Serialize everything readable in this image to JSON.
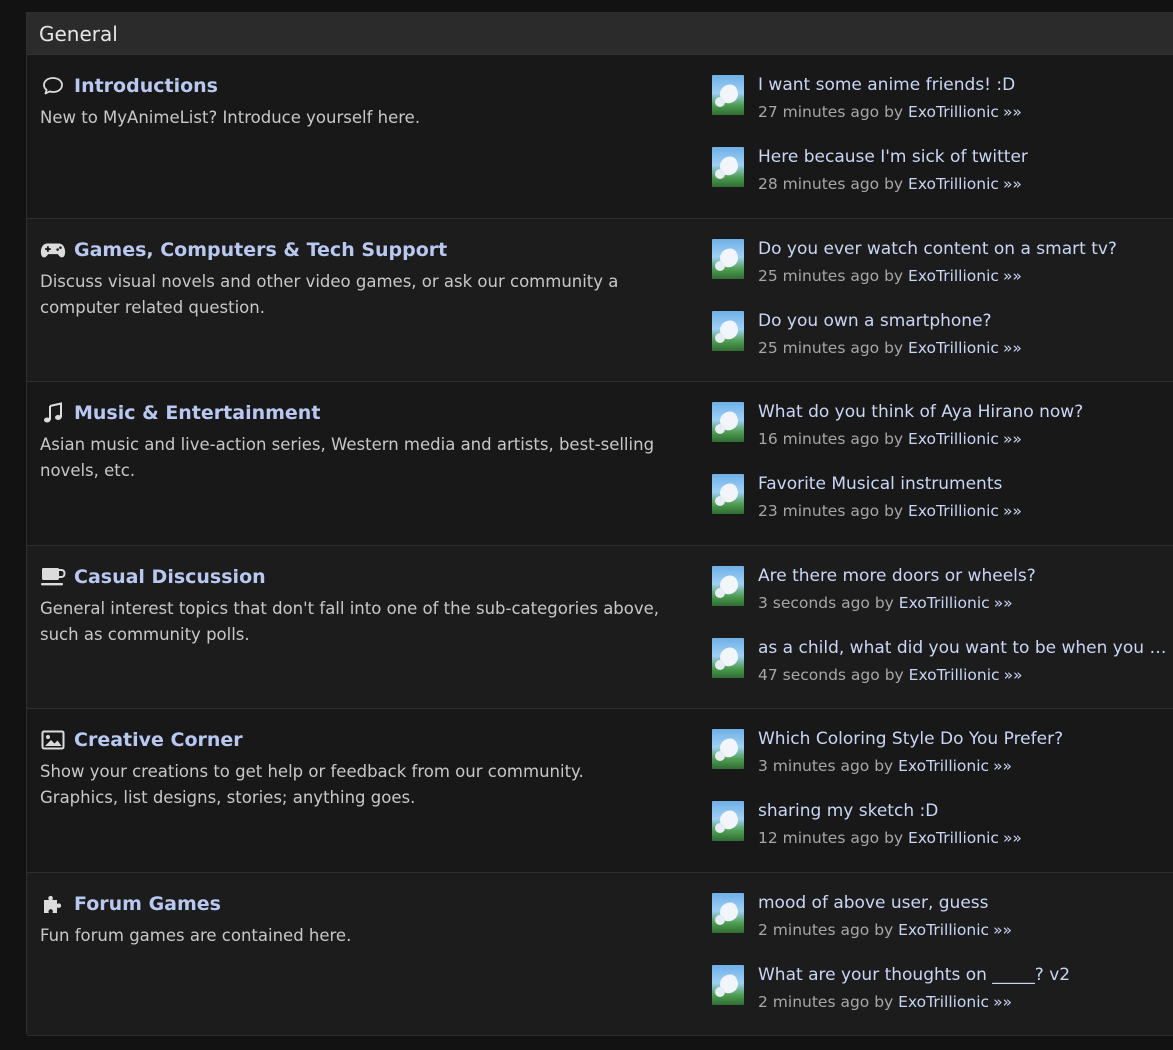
{
  "section": {
    "title": "General"
  },
  "boards": [
    {
      "icon": "speech-bubble-icon",
      "title": "Introductions",
      "desc": "New to MyAnimeList? Introduce yourself here.",
      "posts": [
        {
          "title": "I want some anime friends! :D",
          "time": "27 minutes ago",
          "by": "by",
          "user": "ExoTrillionic",
          "more": "»»"
        },
        {
          "title": "Here because I'm sick of twitter",
          "time": "28 minutes ago",
          "by": "by",
          "user": "ExoTrillionic",
          "more": "»»"
        }
      ]
    },
    {
      "icon": "gamepad-icon",
      "title": "Games, Computers & Tech Support",
      "desc": "Discuss visual novels and other video games, or ask our community a computer related question.",
      "posts": [
        {
          "title": "Do you ever watch content on a smart tv?",
          "time": "25 minutes ago",
          "by": "by",
          "user": "ExoTrillionic",
          "more": "»»"
        },
        {
          "title": "Do you own a smartphone?",
          "time": "25 minutes ago",
          "by": "by",
          "user": "ExoTrillionic",
          "more": "»»"
        }
      ]
    },
    {
      "icon": "music-note-icon",
      "title": "Music & Entertainment",
      "desc": "Asian music and live-action series, Western media and artists, best-selling novels, etc.",
      "posts": [
        {
          "title": "What do you think of Aya Hirano now?",
          "time": "16 minutes ago",
          "by": "by",
          "user": "ExoTrillionic",
          "more": "»»"
        },
        {
          "title": "Favorite Musical instruments",
          "time": "23 minutes ago",
          "by": "by",
          "user": "ExoTrillionic",
          "more": "»»"
        }
      ]
    },
    {
      "icon": "coffee-cup-icon",
      "title": "Casual Discussion",
      "desc": "General interest topics that don't fall into one of the sub-categories above, such as community polls.",
      "posts": [
        {
          "title": "Are there more doors or wheels?",
          "time": "3 seconds ago",
          "by": "by",
          "user": "ExoTrillionic",
          "more": "»»"
        },
        {
          "title": "as a child, what did you want to be when you grew up?",
          "time": "47 seconds ago",
          "by": "by",
          "user": "ExoTrillionic",
          "more": "»»"
        }
      ]
    },
    {
      "icon": "image-icon",
      "title": "Creative Corner",
      "desc": "Show your creations to get help or feedback from our community. Graphics, list designs, stories; anything goes.",
      "posts": [
        {
          "title": "Which Coloring Style Do You Prefer?",
          "time": "3 minutes ago",
          "by": "by",
          "user": "ExoTrillionic",
          "more": "»»"
        },
        {
          "title": "sharing my sketch :D",
          "time": "12 minutes ago",
          "by": "by",
          "user": "ExoTrillionic",
          "more": "»»"
        }
      ]
    },
    {
      "icon": "puzzle-piece-icon",
      "title": "Forum Games",
      "desc": "Fun forum games are contained here.",
      "posts": [
        {
          "title": "mood of above user, guess",
          "time": "2 minutes ago",
          "by": "by",
          "user": "ExoTrillionic",
          "more": "»»"
        },
        {
          "title": "What are your thoughts on _____? v2",
          "time": "2 minutes ago",
          "by": "by",
          "user": "ExoTrillionic",
          "more": "»»"
        }
      ]
    }
  ]
}
